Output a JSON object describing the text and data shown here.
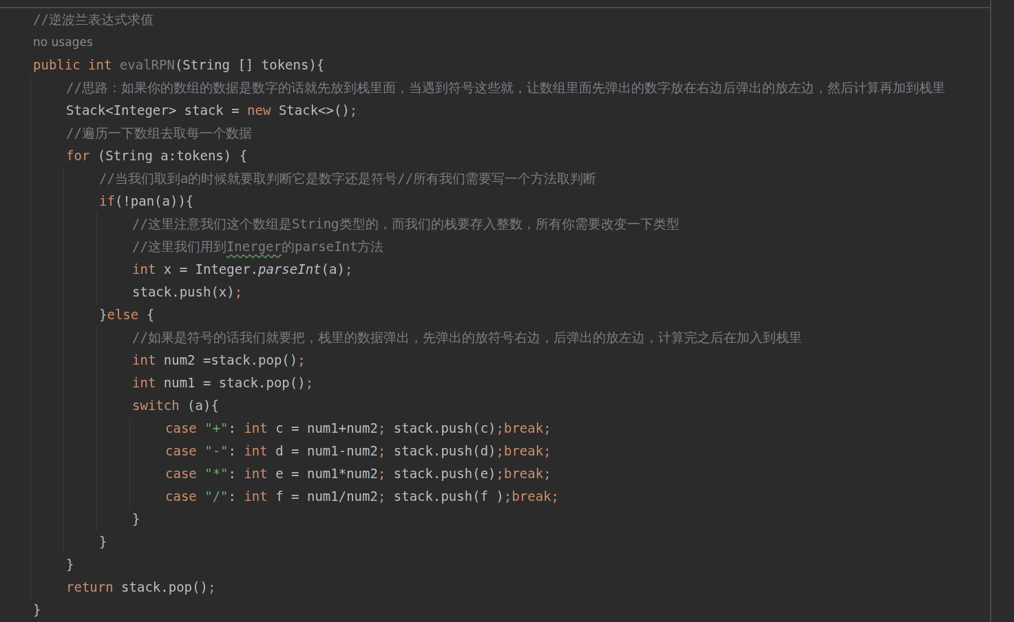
{
  "lines": [
    {
      "tokens": [
        {
          "kind": "comment",
          "text": "//逆波兰表达式求值"
        }
      ]
    },
    {
      "kind": "hint",
      "tokens": [
        {
          "kind": "hint",
          "text": "no usages"
        }
      ]
    },
    {
      "tokens": [
        {
          "kind": "keyword",
          "text": "public int "
        },
        {
          "kind": "unused",
          "text": "evalRPN"
        },
        {
          "kind": "plain",
          "text": "(String [] tokens){"
        }
      ],
      "children": [
        {
          "tokens": [
            {
              "kind": "comment",
              "text": "//思路：如果你的数组的数据是数字的话就先放到栈里面，当遇到符号这些就，让数组里面先弹出的数字放在右边后弹出的放左边，然后计算再加到栈里"
            }
          ]
        },
        {
          "tokens": [
            {
              "kind": "plain",
              "text": "Stack<Integer> stack = "
            },
            {
              "kind": "keyword",
              "text": "new "
            },
            {
              "kind": "plain",
              "text": "Stack<>()"
            },
            {
              "kind": "keyword",
              "text": ";"
            }
          ]
        },
        {
          "tokens": [
            {
              "kind": "comment",
              "text": "//遍历一下数组去取每一个数据"
            }
          ]
        },
        {
          "tokens": [
            {
              "kind": "keyword",
              "text": "for "
            },
            {
              "kind": "plain",
              "text": "(String a:tokens) {"
            }
          ],
          "children": [
            {
              "tokens": [
                {
                  "kind": "comment",
                  "text": "//当我们取到a的时候就要取判断它是数字还是符号//所有我们需要写一个方法取判断"
                }
              ]
            },
            {
              "tokens": [
                {
                  "kind": "keyword",
                  "text": "if"
                },
                {
                  "kind": "plain",
                  "text": "(!pan(a)){"
                }
              ],
              "children": [
                {
                  "tokens": [
                    {
                      "kind": "comment",
                      "text": "//这里注意我们这个数组是String类型的，而我们的栈要存入整数，所有你需要改变一下类型"
                    }
                  ]
                },
                {
                  "tokens": [
                    {
                      "kind": "comment",
                      "text": "//这里我们用到"
                    },
                    {
                      "kind": "typo",
                      "text": "Inerger"
                    },
                    {
                      "kind": "comment",
                      "text": "的parseInt方法"
                    }
                  ]
                },
                {
                  "tokens": [
                    {
                      "kind": "keyword",
                      "text": "int "
                    },
                    {
                      "kind": "plain",
                      "text": "x = Integer."
                    },
                    {
                      "kind": "italic",
                      "text": "parseInt"
                    },
                    {
                      "kind": "plain",
                      "text": "(a)"
                    },
                    {
                      "kind": "keyword",
                      "text": ";"
                    }
                  ]
                },
                {
                  "tokens": [
                    {
                      "kind": "plain",
                      "text": "stack.push(x)"
                    },
                    {
                      "kind": "keyword",
                      "text": ";"
                    }
                  ]
                }
              ]
            },
            {
              "tokens": [
                {
                  "kind": "plain",
                  "text": "}"
                },
                {
                  "kind": "keyword",
                  "text": "else "
                },
                {
                  "kind": "plain",
                  "text": "{"
                }
              ],
              "children": [
                {
                  "tokens": [
                    {
                      "kind": "comment",
                      "text": "//如果是符号的话我们就要把，栈里的数据弹出，先弹出的放符号右边，后弹出的放左边，计算完之后在加入到栈里"
                    }
                  ]
                },
                {
                  "tokens": [
                    {
                      "kind": "keyword",
                      "text": "int "
                    },
                    {
                      "kind": "plain",
                      "text": "num2 =stack.pop()"
                    },
                    {
                      "kind": "keyword",
                      "text": ";"
                    }
                  ]
                },
                {
                  "tokens": [
                    {
                      "kind": "keyword",
                      "text": "int "
                    },
                    {
                      "kind": "plain",
                      "text": "num1 = stack.pop()"
                    },
                    {
                      "kind": "keyword",
                      "text": ";"
                    }
                  ]
                },
                {
                  "tokens": [
                    {
                      "kind": "keyword",
                      "text": "switch "
                    },
                    {
                      "kind": "plain",
                      "text": "(a){"
                    }
                  ],
                  "children": [
                    {
                      "tokens": [
                        {
                          "kind": "keyword",
                          "text": "case "
                        },
                        {
                          "kind": "string",
                          "text": "\"+\""
                        },
                        {
                          "kind": "plain",
                          "text": ": "
                        },
                        {
                          "kind": "keyword",
                          "text": "int "
                        },
                        {
                          "kind": "plain",
                          "text": "c = num1+num2"
                        },
                        {
                          "kind": "keyword",
                          "text": "; "
                        },
                        {
                          "kind": "plain",
                          "text": "stack.push(c)"
                        },
                        {
                          "kind": "keyword",
                          "text": ";break;"
                        }
                      ]
                    },
                    {
                      "tokens": [
                        {
                          "kind": "keyword",
                          "text": "case "
                        },
                        {
                          "kind": "string",
                          "text": "\"-\""
                        },
                        {
                          "kind": "plain",
                          "text": ": "
                        },
                        {
                          "kind": "keyword",
                          "text": "int "
                        },
                        {
                          "kind": "plain",
                          "text": "d = num1-num2"
                        },
                        {
                          "kind": "keyword",
                          "text": "; "
                        },
                        {
                          "kind": "plain",
                          "text": "stack.push(d)"
                        },
                        {
                          "kind": "keyword",
                          "text": ";break;"
                        }
                      ]
                    },
                    {
                      "tokens": [
                        {
                          "kind": "keyword",
                          "text": "case "
                        },
                        {
                          "kind": "string",
                          "text": "\"*\""
                        },
                        {
                          "kind": "plain",
                          "text": ": "
                        },
                        {
                          "kind": "keyword",
                          "text": "int "
                        },
                        {
                          "kind": "plain",
                          "text": "e = num1*num2"
                        },
                        {
                          "kind": "keyword",
                          "text": "; "
                        },
                        {
                          "kind": "plain",
                          "text": "stack.push(e)"
                        },
                        {
                          "kind": "keyword",
                          "text": ";break;"
                        }
                      ]
                    },
                    {
                      "tokens": [
                        {
                          "kind": "keyword",
                          "text": "case "
                        },
                        {
                          "kind": "string",
                          "text": "\"/\""
                        },
                        {
                          "kind": "plain",
                          "text": ": "
                        },
                        {
                          "kind": "keyword",
                          "text": "int "
                        },
                        {
                          "kind": "plain",
                          "text": "f = num1/num2"
                        },
                        {
                          "kind": "keyword",
                          "text": "; "
                        },
                        {
                          "kind": "plain",
                          "text": "stack.push(f )"
                        },
                        {
                          "kind": "keyword",
                          "text": ";break;"
                        }
                      ]
                    }
                  ]
                },
                {
                  "tokens": [
                    {
                      "kind": "plain",
                      "text": "}"
                    }
                  ]
                }
              ]
            },
            {
              "tokens": [
                {
                  "kind": "plain",
                  "text": "}"
                }
              ]
            }
          ]
        },
        {
          "tokens": [
            {
              "kind": "plain",
              "text": "}"
            }
          ]
        },
        {
          "tokens": [
            {
              "kind": "keyword",
              "text": "return "
            },
            {
              "kind": "plain",
              "text": "stack.pop()"
            },
            {
              "kind": "keyword",
              "text": ";"
            }
          ]
        }
      ]
    },
    {
      "tokens": [
        {
          "kind": "plain",
          "text": "}"
        }
      ]
    }
  ]
}
